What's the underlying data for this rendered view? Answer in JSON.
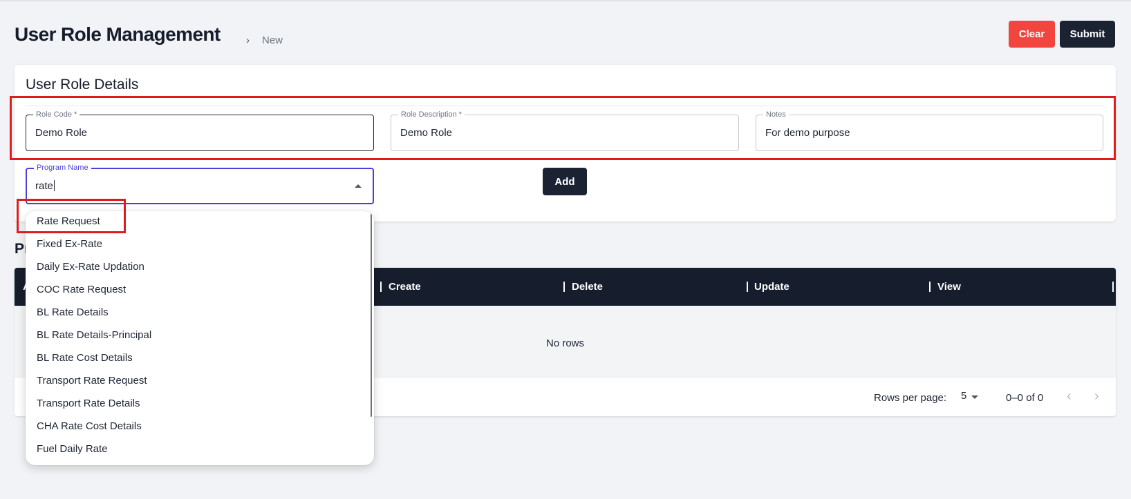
{
  "header": {
    "title": "User Role Management",
    "breadcrumb_current": "New",
    "clear_label": "Clear",
    "submit_label": "Submit"
  },
  "details": {
    "title": "User Role Details",
    "role_code": {
      "label": "Role Code *",
      "value": "Demo Role"
    },
    "role_description": {
      "label": "Role Description *",
      "value": "Demo Role"
    },
    "notes": {
      "label": "Notes",
      "value": "For demo purpose"
    },
    "program_name": {
      "label": "Program Name",
      "value": "rate"
    },
    "add_label": "Add"
  },
  "dropdown": {
    "options": [
      "Rate Request",
      "Fixed Ex-Rate",
      "Daily Ex-Rate Updation",
      "COC Rate Request",
      "BL Rate Details",
      "BL Rate Details-Principal",
      "BL Rate Cost Details",
      "Transport Rate Request",
      "Transport Rate Details",
      "CHA Rate Cost Details",
      "Fuel Daily Rate"
    ]
  },
  "permissions": {
    "title_visible": "Pr",
    "columns": [
      "A",
      "Create",
      "Delete",
      "Update",
      "View"
    ],
    "empty_text": "No rows",
    "rows_per_page_label": "Rows per page:",
    "rows_per_page_value": "5",
    "range_text": "0–0 of 0"
  },
  "colors": {
    "clear": "#f2453d",
    "dark": "#1b2333",
    "focus": "#4b3fd8",
    "highlight": "#e01b1b"
  }
}
